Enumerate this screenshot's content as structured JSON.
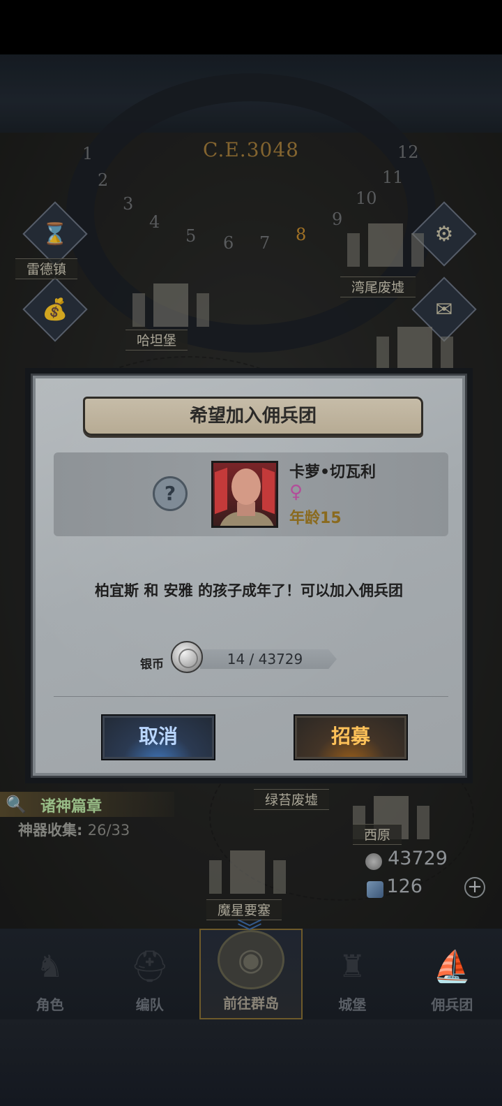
{
  "calendar": {
    "year": "C.E.3048",
    "numbers": [
      "1",
      "2",
      "3",
      "4",
      "5",
      "6",
      "7",
      "8",
      "9",
      "10",
      "11",
      "12"
    ],
    "active_month": "8"
  },
  "map": {
    "places": [
      {
        "name": "雷德镇"
      },
      {
        "name": "湾尾废墟"
      },
      {
        "name": "哈坦堡"
      },
      {
        "name": "绿苔废墟"
      },
      {
        "name": "西原"
      },
      {
        "name": "魔星要塞"
      }
    ],
    "quest": {
      "title": "诸神篇章",
      "artifact_label": "神器收集:",
      "artifact_value": "26/33"
    },
    "resources": {
      "silver": "43729",
      "crystal": "126"
    },
    "side_icons": [
      "hourglass-icon",
      "money-bag-icon",
      "gear-icon",
      "mail-icon"
    ]
  },
  "dialog": {
    "title": "希望加入佣兵团",
    "character": {
      "name": "卡萝•切瓦利",
      "gender_symbol": "♀",
      "age_label": "年龄",
      "age_value": "15"
    },
    "unknown_symbol": "?",
    "message": "柏宜斯 和 安雅 的孩子成年了！可以加入佣兵团",
    "cost": {
      "label": "银币",
      "text": "14 / 43729",
      "owned": 14,
      "required": 43729
    },
    "buttons": {
      "cancel": "取消",
      "recruit": "招募"
    }
  },
  "bottom_nav": {
    "items": [
      {
        "label": "角色",
        "icon": "knight-icon"
      },
      {
        "label": "编队",
        "icon": "helmet-icon"
      },
      {
        "label": "前往群岛",
        "icon": "globe-icon",
        "active": true
      },
      {
        "label": "城堡",
        "icon": "castle-icon"
      },
      {
        "label": "佣兵团",
        "icon": "ship-icon"
      }
    ]
  },
  "colors": {
    "cancel_text": "#b9d6ff",
    "recruit_text": "#ffc259",
    "quest_title": "#b9e4a4",
    "calendar_active": "#c48a2e"
  }
}
